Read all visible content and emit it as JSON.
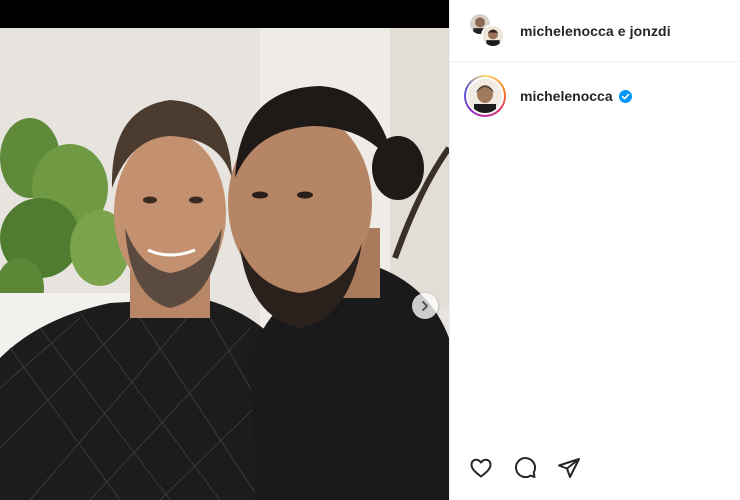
{
  "header": {
    "title": "michelenocca e jonzdi",
    "avatars": [
      "avatar-michelenocca",
      "avatar-jonzdi"
    ]
  },
  "author": {
    "username": "michelenocca",
    "verified": true
  },
  "media": {
    "carousel_next_icon": "chevron-right-icon"
  },
  "actions": {
    "like_icon": "heart-icon",
    "comment_icon": "comment-icon",
    "share_icon": "paper-plane-icon"
  },
  "colors": {
    "verified_blue": "#0095f6",
    "text": "#262626",
    "divider": "#efefef"
  }
}
